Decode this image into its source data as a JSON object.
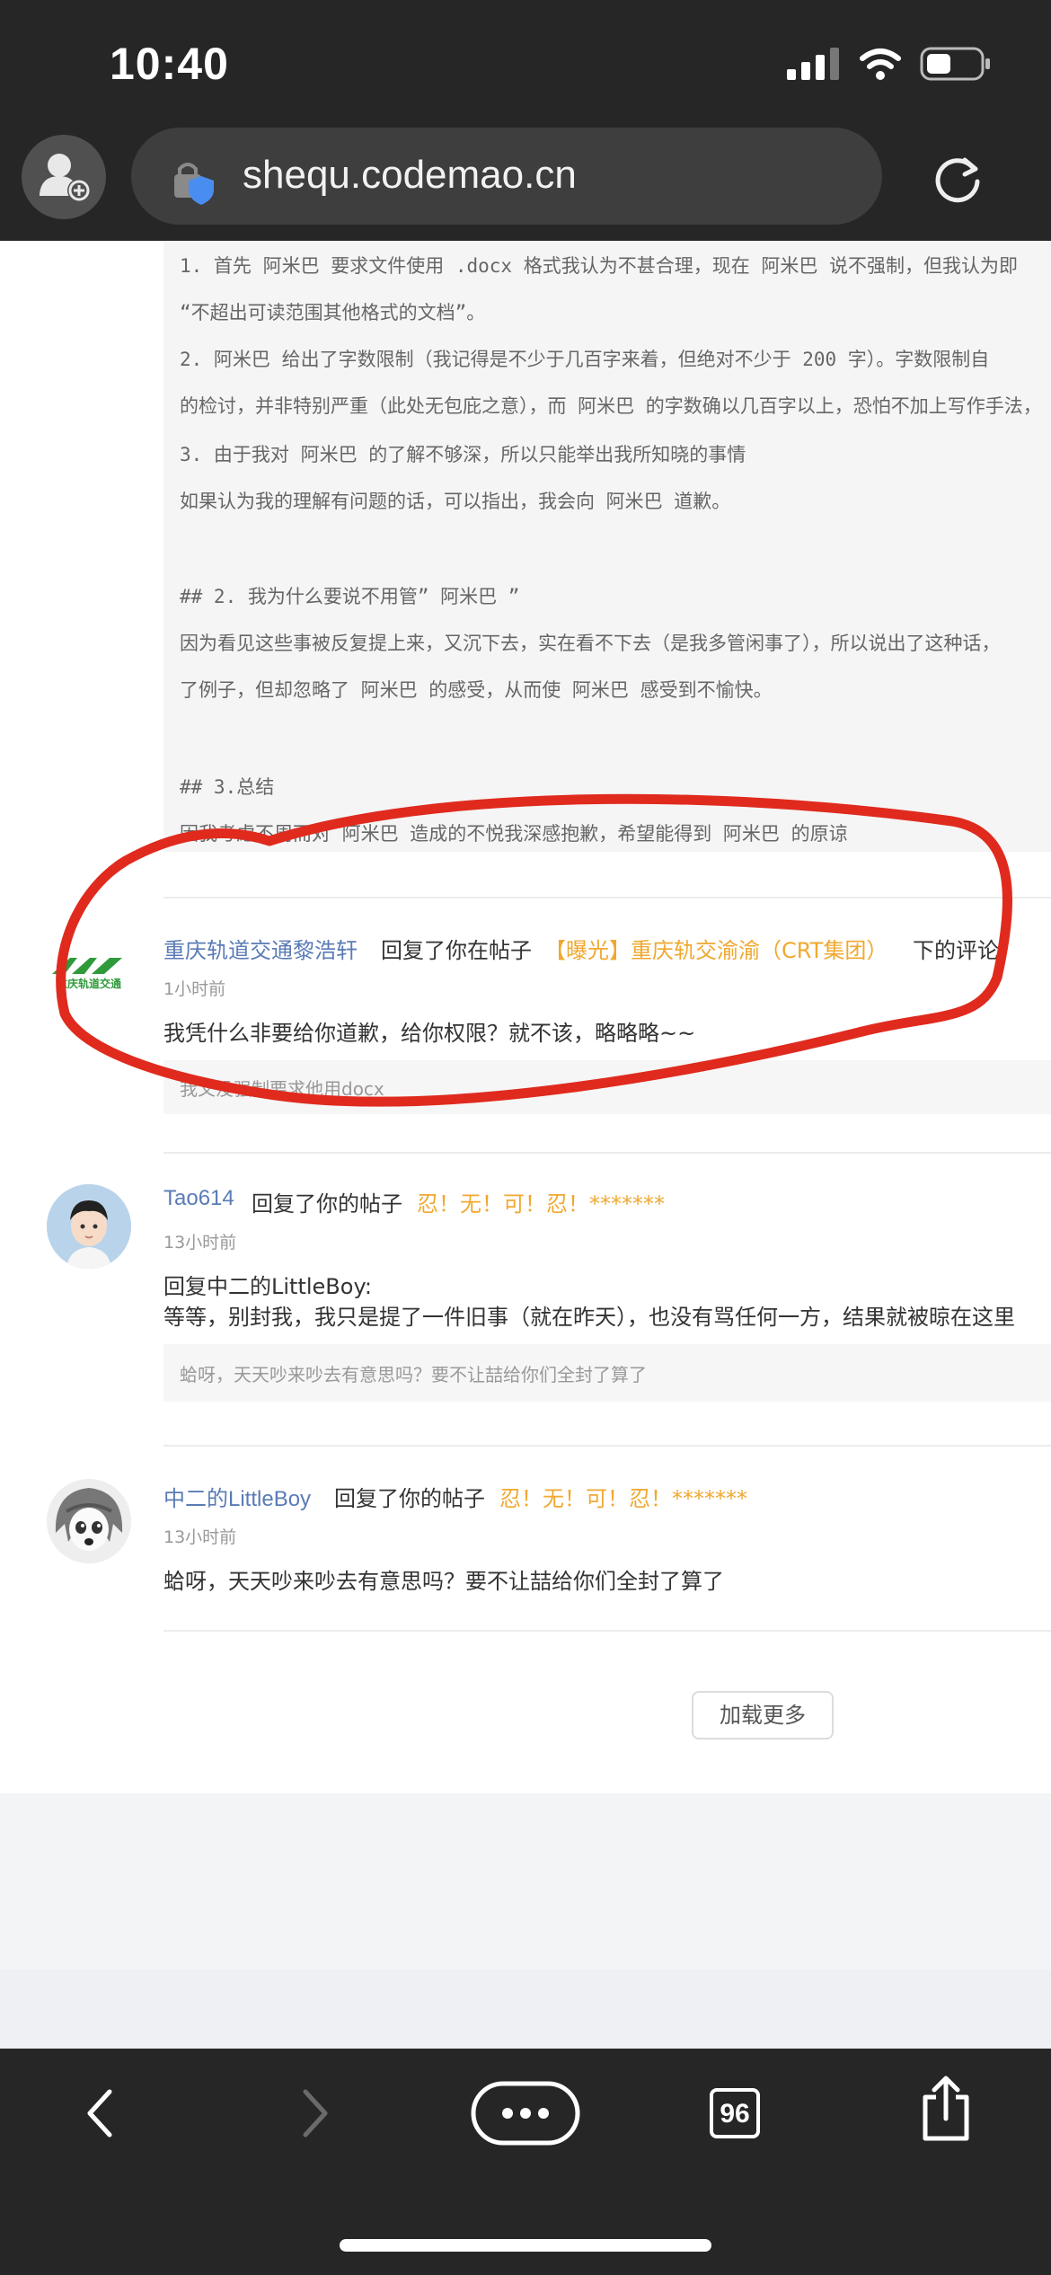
{
  "status": {
    "time": "10:40"
  },
  "browser": {
    "url": "shequ.codemao.cn",
    "tab_count": "96"
  },
  "post_quote": {
    "lines": [
      "    1. 首先 阿米巴 要求文件使用 .docx 格式我认为不甚合理，现在 阿米巴 说不强制，但我认为即",
      "“不超出可读范围其他格式的文档”。",
      "    2.  阿米巴 给出了字数限制（我记得是不少于几百字来着，但绝对不少于 200 字）。字数限制自",
      "的检讨，并非特别严重（此处无包庇之意），而 阿米巴 的字数确以几百字以上，恐怕不加上写作手法，",
      "    3. 由于我对 阿米巴 的了解不够深，所以只能举出我所知晓的事情",
      "    如果认为我的理解有问题的话，可以指出，我会向 阿米巴 道歉。",
      "## 2. 我为什么要说不用管” 阿米巴 ”",
      "    因为看见这些事被反复提上来，又沉下去，实在看不下去（是我多管闲事了），所以说出了这种话，",
      "了例子，但却忽略了 阿米巴 的感受，从而使 阿米巴 感受到不愉快。",
      "## 3.总结",
      "    因我考虑不周而对 阿米巴 造成的不悦我深感抱歉，希望能得到 阿米巴 的原谅"
    ]
  },
  "comments": [
    {
      "user": "重庆轨道交通黎浩轩",
      "action": "回复了你在帖子",
      "post_title": "【曝光】重庆轨交渝渝（CRT集团）",
      "suffix": "下的评论",
      "time": "1小时前",
      "text": "我凭什么非要给你道歉，给你权限？就不该，略略略~~",
      "quote": "我又没强制要求他用docx",
      "avatar_logo_text": "重庆轨道交通"
    },
    {
      "user": "Tao614",
      "action": "回复了你的帖子",
      "post_title": "忍！无！可！忍！*******",
      "time": "13小时前",
      "text_line1": "回复中二的LittleBoy:",
      "text_line2": "等等，别封我，我只是提了一件旧事（就在昨天），也没有骂任何一方，结果就被晾在这里",
      "quote": "蛤呀，天天吵来吵去有意思吗？要不让喆给你们全封了算了"
    },
    {
      "user": "中二的LittleBoy",
      "action": "回复了你的帖子",
      "post_title": "忍！无！可！忍！*******",
      "time": "13小时前",
      "text": "蛤呀，天天吵来吵去有意思吗？要不让喆给你们全封了算了"
    }
  ],
  "load_more_label": "加载更多",
  "colors": {
    "link": "#5a7bb5",
    "highlight": "#f0a830",
    "annotation": "#e02a1e",
    "bar": "#262626"
  }
}
